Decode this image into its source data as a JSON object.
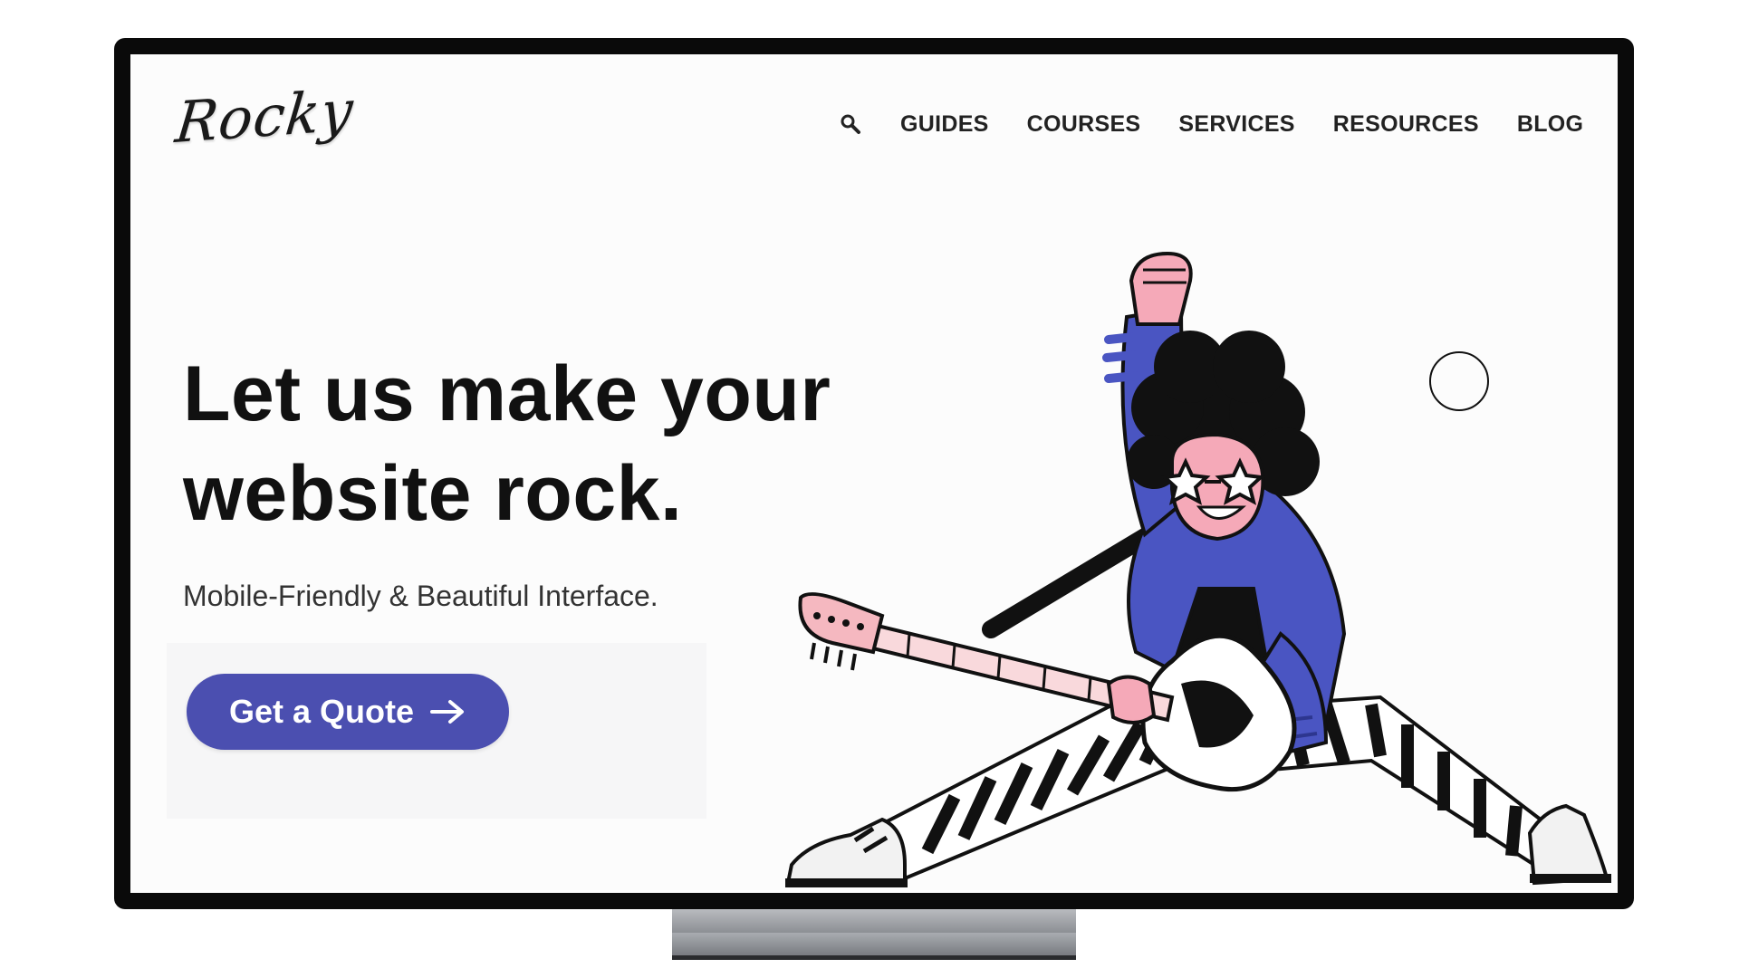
{
  "brand": {
    "logo_text": "Rocky"
  },
  "nav": {
    "search_icon": "search-icon",
    "items": [
      {
        "label": "GUIDES"
      },
      {
        "label": "COURSES"
      },
      {
        "label": "SERVICES"
      },
      {
        "label": "RESOURCES"
      },
      {
        "label": "BLOG"
      }
    ]
  },
  "hero": {
    "headline_line1": "Let us make your",
    "headline_line2": "website rock.",
    "subheadline": "Mobile-Friendly & Beautiful Interface.",
    "cta_label": "Get a Quote",
    "cta_icon": "arrow-right-icon"
  },
  "illustration": {
    "subject": "rocker-guitarist-illustration"
  },
  "colors": {
    "accent": "#4b4fb0",
    "jacket": "#4a55c2",
    "frame": "#0a0a0a",
    "screen_bg": "#fcfcfc"
  }
}
